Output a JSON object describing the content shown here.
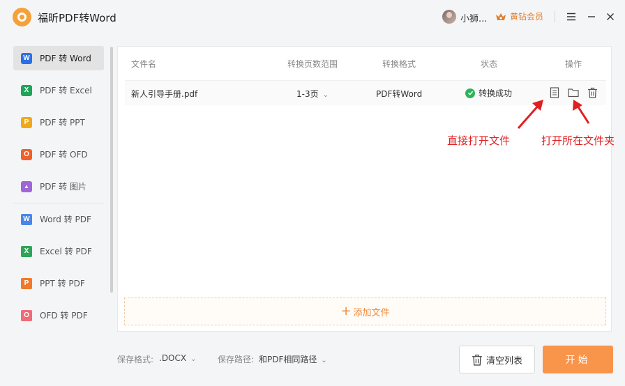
{
  "app": {
    "title": "福昕PDF转Word"
  },
  "user": {
    "name": "小狮...",
    "vip_label": "黄钻会员"
  },
  "sidebar": {
    "items": [
      {
        "label": "PDF 转 Word",
        "icon": "word-icon",
        "badge": "W",
        "color": "#2b6fe8",
        "active": true
      },
      {
        "label": "PDF 转 Excel",
        "icon": "excel-icon",
        "badge": "X",
        "color": "#21a35a"
      },
      {
        "label": "PDF 转 PPT",
        "icon": "ppt-icon",
        "badge": "P",
        "color": "#f0a818"
      },
      {
        "label": "PDF 转 OFD",
        "icon": "ofd-icon",
        "badge": "O",
        "color": "#f2602a"
      },
      {
        "label": "PDF 转 图片",
        "icon": "image-icon",
        "badge": "▲",
        "color": "#a066d8"
      },
      {
        "label": "Word 转 PDF",
        "icon": "word-outline-icon",
        "badge": "W",
        "color": "#4a86e8"
      },
      {
        "label": "Excel 转 PDF",
        "icon": "excel-outline-icon",
        "badge": "X",
        "color": "#2fa457"
      },
      {
        "label": "PPT 转 PDF",
        "icon": "ppt-outline-icon",
        "badge": "P",
        "color": "#f07a2a"
      },
      {
        "label": "OFD 转 PDF",
        "icon": "ofd-outline-icon",
        "badge": "O",
        "color": "#ef6b78"
      }
    ]
  },
  "table": {
    "headers": {
      "name": "文件名",
      "range": "转换页数范围",
      "format": "转换格式",
      "status": "状态",
      "ops": "操作"
    },
    "rows": [
      {
        "name": "新人引导手册.pdf",
        "range": "1-3页",
        "format": "PDF转Word",
        "status": "转换成功"
      }
    ]
  },
  "annotations": {
    "open_file": "直接打开文件",
    "open_folder": "打开所在文件夹"
  },
  "add_file": {
    "label": "添加文件"
  },
  "bottom": {
    "format_label": "保存格式:",
    "format_value": ".DOCX",
    "path_label": "保存路径:",
    "path_value": "和PDF相同路径",
    "clear_label": "清空列表",
    "start_label": "开始"
  },
  "colors": {
    "accent": "#f9944b",
    "success": "#2fb35a",
    "annotation": "#e02020"
  }
}
